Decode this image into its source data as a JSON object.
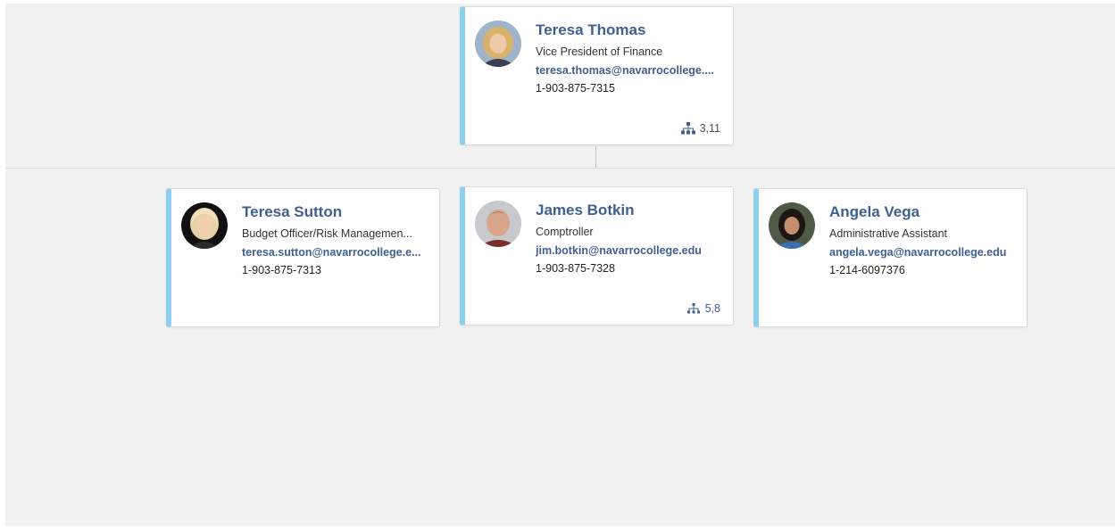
{
  "colors": {
    "accent_bar": "#8dd0ee",
    "name_text": "#3e5f92",
    "background": "#f1f1f1"
  },
  "root": {
    "name": "Teresa Thomas",
    "title": "Vice President of Finance",
    "email": "teresa.thomas@navarrocollege....",
    "phone": "1-903-875-7315",
    "reports": "3,11",
    "avatar_icon": "person-photo-blonde-woman"
  },
  "children": [
    {
      "name": "Teresa Sutton",
      "title": "Budget Officer/Risk Managemen...",
      "email": "teresa.sutton@navarrocollege.e...",
      "phone": "1-903-875-7313",
      "avatar_icon": "person-photo-blonde-woman-dark-bg"
    },
    {
      "name": "James Botkin",
      "title": "Comptroller",
      "email": "jim.botkin@navarrocollege.edu",
      "phone": "1-903-875-7328",
      "reports": "5,8",
      "avatar_icon": "person-photo-man"
    },
    {
      "name": "Angela Vega",
      "title": "Administrative Assistant",
      "email": "angela.vega@navarrocollege.edu",
      "phone": "1-214-6097376",
      "avatar_icon": "person-photo-dark-haired-woman"
    }
  ]
}
